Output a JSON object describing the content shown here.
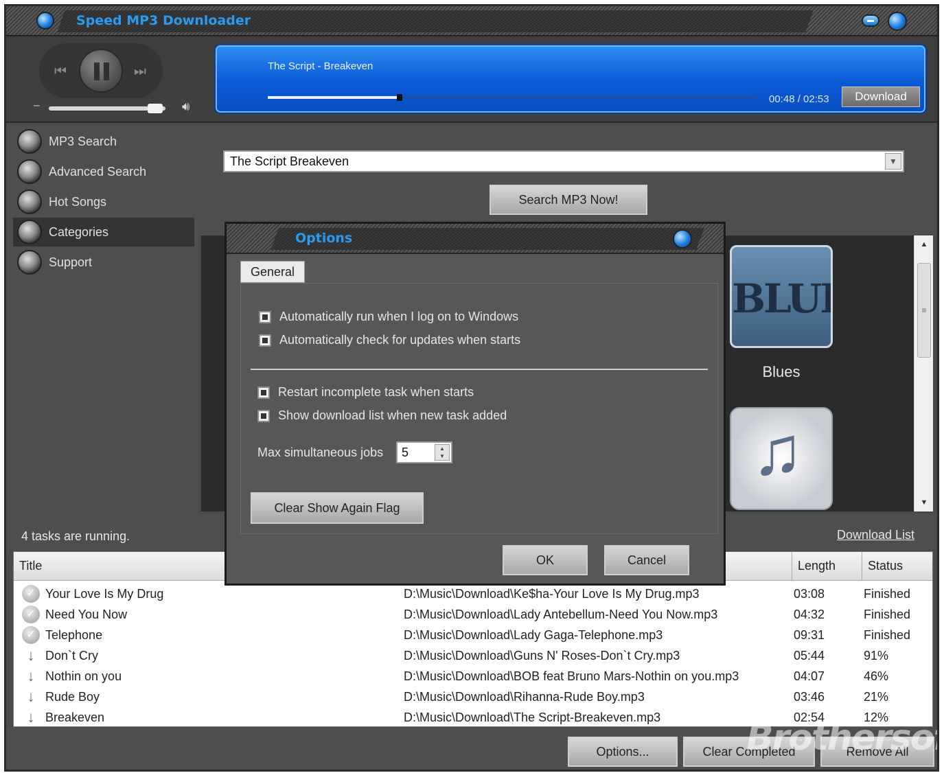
{
  "window": {
    "title": "Speed MP3 Downloader"
  },
  "player": {
    "track": "The Script - Breakeven",
    "time": "00:48 / 02:53",
    "progress": 0.27,
    "volume": 0.95,
    "download_label": "Download"
  },
  "sidebar": {
    "items": [
      {
        "label": "MP3 Search",
        "icon": "mp3-search-icon"
      },
      {
        "label": "Advanced Search",
        "icon": "advanced-search-icon"
      },
      {
        "label": "Hot Songs",
        "icon": "hot-songs-icon"
      },
      {
        "label": "Categories",
        "icon": "categories-icon",
        "active": true
      },
      {
        "label": "Support",
        "icon": "support-icon"
      }
    ]
  },
  "search": {
    "query": "The Script Breakeven",
    "button_label": "Search MP3 Now!"
  },
  "categories": [
    {
      "label": "Blues",
      "tile_text": "BLUES"
    }
  ],
  "status": {
    "tasks_running": "4 tasks are running.",
    "download_list_link": "Download List"
  },
  "table": {
    "columns": [
      "Title",
      "Length",
      "Status"
    ],
    "rows": [
      {
        "title": "Your Love Is My Drug",
        "path": "D:\\Music\\Download\\Ke$ha-Your Love Is My Drug.mp3",
        "length": "03:08",
        "status": "Finished",
        "state": "done"
      },
      {
        "title": "Need You Now",
        "path": "D:\\Music\\Download\\Lady Antebellum-Need You Now.mp3",
        "length": "04:32",
        "status": "Finished",
        "state": "done"
      },
      {
        "title": "Telephone",
        "path": "D:\\Music\\Download\\Lady Gaga-Telephone.mp3",
        "length": "09:31",
        "status": "Finished",
        "state": "done"
      },
      {
        "title": "Don`t Cry",
        "path": "D:\\Music\\Download\\Guns N' Roses-Don`t Cry.mp3",
        "length": "05:44",
        "status": "91%",
        "state": "downloading"
      },
      {
        "title": "Nothin on you",
        "path": "D:\\Music\\Download\\BOB feat Bruno Mars-Nothin on you.mp3",
        "length": "04:07",
        "status": "46%",
        "state": "downloading"
      },
      {
        "title": "Rude Boy",
        "path": "D:\\Music\\Download\\Rihanna-Rude Boy.mp3",
        "length": "03:46",
        "status": "21%",
        "state": "downloading"
      },
      {
        "title": "Breakeven",
        "path": "D:\\Music\\Download\\The Script-Breakeven.mp3",
        "length": "02:54",
        "status": "12%",
        "state": "downloading"
      }
    ]
  },
  "bottom_buttons": {
    "options": "Options...",
    "clear_completed": "Clear Completed",
    "remove_all": "Remove All"
  },
  "watermark": "Brothersoft",
  "dialog": {
    "title": "Options",
    "tab": "General",
    "checkboxes": [
      "Automatically run when I log on to Windows",
      "Automatically check for updates when starts",
      "Restart incomplete task when starts",
      "Show download list when new task added"
    ],
    "max_jobs_label": "Max simultaneous jobs",
    "max_jobs_value": "5",
    "clear_flag_label": "Clear Show Again Flag",
    "ok_label": "OK",
    "cancel_label": "Cancel"
  }
}
